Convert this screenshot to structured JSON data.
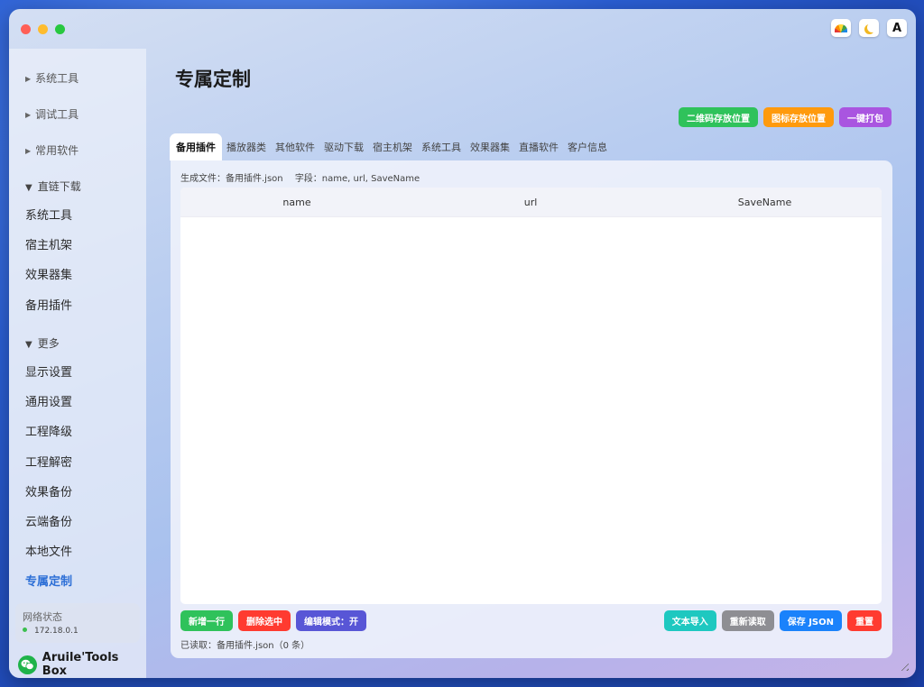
{
  "window": {
    "top_icons": [
      {
        "icon": "rainbow-icon"
      },
      {
        "icon": "moon-icon"
      },
      {
        "icon": "font-icon",
        "label": "A"
      }
    ]
  },
  "sidebar": {
    "groups": [
      {
        "label": "系统工具"
      },
      {
        "label": "调试工具"
      },
      {
        "label": "常用软件"
      }
    ],
    "sections": [
      {
        "label": "直链下载",
        "items": [
          "系统工具",
          "宿主机架",
          "效果器集",
          "备用插件"
        ]
      },
      {
        "label": "更多",
        "items": [
          "显示设置",
          "通用设置",
          "工程降级",
          "工程解密",
          "效果备份",
          "云端备份",
          "本地文件",
          "专属定制"
        ]
      }
    ],
    "active_item": "专属定制",
    "network": {
      "title": "网络状态",
      "ip": "172.18.0.1",
      "status_color": "#3bbf4e"
    },
    "brand": "Aruile'Tools Box"
  },
  "main": {
    "title": "专属定制",
    "actions": [
      "二维码存放位置",
      "图标存放位置",
      "一键打包"
    ],
    "tabs": [
      "备用插件",
      "播放器类",
      "其他软件",
      "驱动下载",
      "宿主机架",
      "系统工具",
      "效果器集",
      "直播软件",
      "客户信息"
    ],
    "active_tab": "备用插件",
    "meta": {
      "file": "生成文件：备用插件.json",
      "fields": "字段：name, url, SaveName"
    },
    "table": {
      "columns": [
        "name",
        "url",
        "SaveName"
      ],
      "rows": []
    },
    "bottom_left": [
      "新增一行",
      "删除选中",
      "编辑模式：开"
    ],
    "bottom_right": [
      "文本导入",
      "重新读取",
      "保存 JSON",
      "重置"
    ],
    "status": "已读取：备用插件.json（0 条）"
  },
  "colors": {
    "green": "#2fc25b",
    "orange": "#ff9a0d",
    "purple": "#a955e0",
    "red": "#ff3b30",
    "indigo": "#5856d6",
    "teal": "#1ec8c0",
    "gray": "#8e8e93",
    "blue": "#1a82fb",
    "active": "#2d6fd6"
  }
}
